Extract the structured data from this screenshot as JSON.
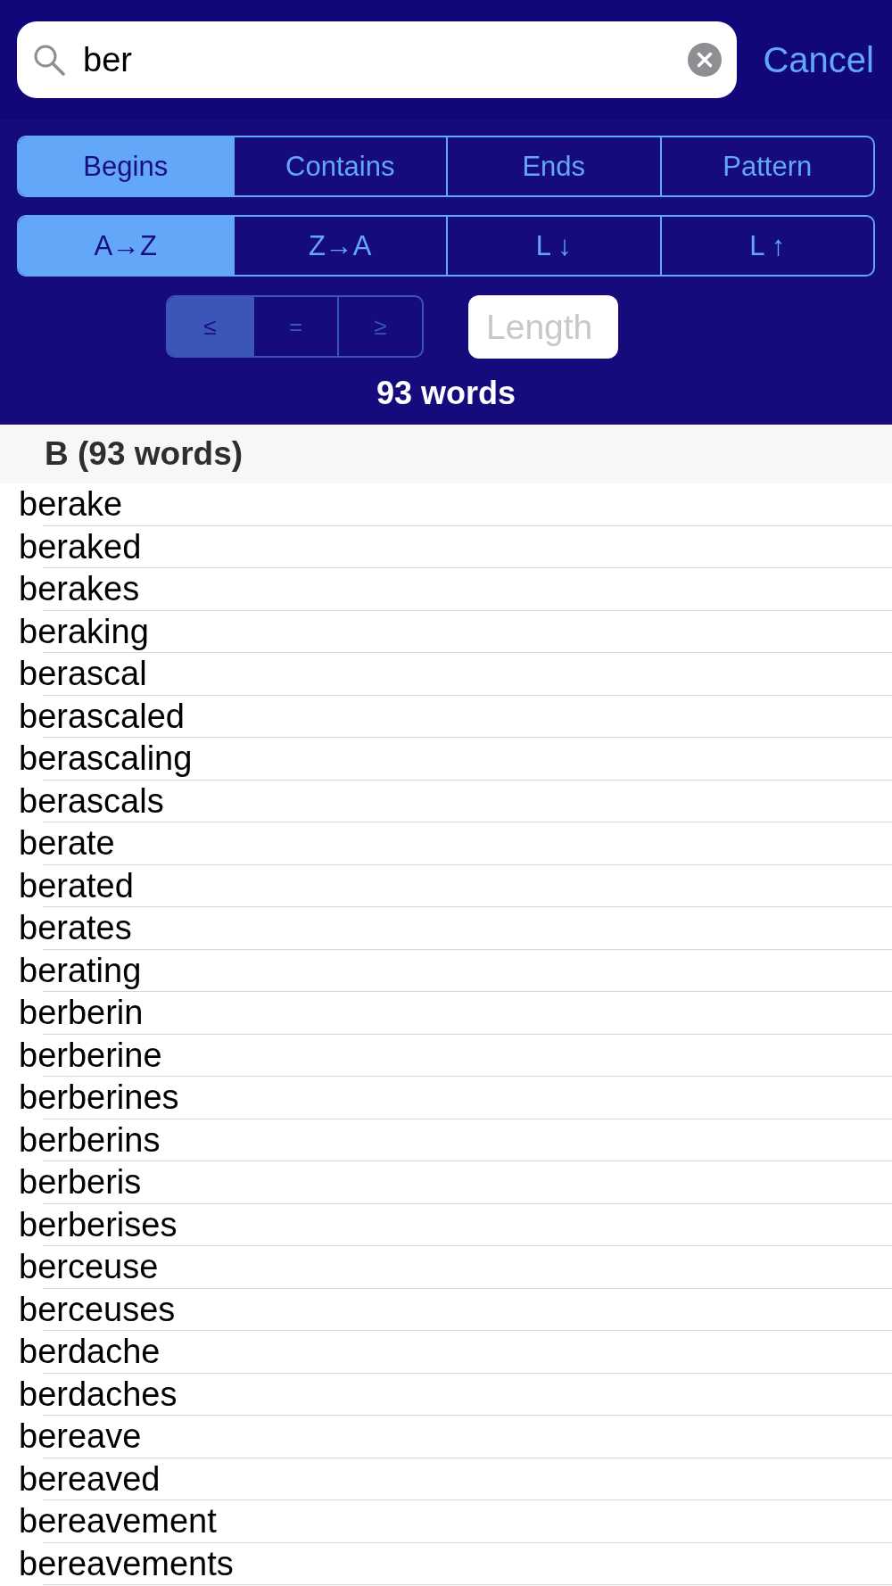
{
  "search_bar": {
    "query": "ber",
    "cancel": "Cancel"
  },
  "match_modes": [
    {
      "label": "Begins",
      "selected": true
    },
    {
      "label": "Contains",
      "selected": false
    },
    {
      "label": "Ends",
      "selected": false
    },
    {
      "label": "Pattern",
      "selected": false
    }
  ],
  "sort_orders": [
    {
      "label": "A→Z",
      "selected": true
    },
    {
      "label": "Z→A",
      "selected": false
    },
    {
      "label": "L ↓",
      "selected": false
    },
    {
      "label": "L ↑",
      "selected": false
    }
  ],
  "length_filter": {
    "disabled": true,
    "comparators": [
      {
        "label": "≤",
        "selected": true
      },
      {
        "label": "=",
        "selected": false
      },
      {
        "label": "≥",
        "selected": false
      }
    ],
    "placeholder": "Length"
  },
  "result_count": "93 words",
  "sections": [
    {
      "header": "B (93 words)",
      "words": [
        "berake",
        "beraked",
        "berakes",
        "beraking",
        "berascal",
        "berascaled",
        "berascaling",
        "berascals",
        "berate",
        "berated",
        "berates",
        "berating",
        "berberin",
        "berberine",
        "berberines",
        "berberins",
        "berberis",
        "berberises",
        "berceuse",
        "berceuses",
        "berdache",
        "berdaches",
        "bereave",
        "bereaved",
        "bereavement",
        "bereavements"
      ]
    }
  ]
}
